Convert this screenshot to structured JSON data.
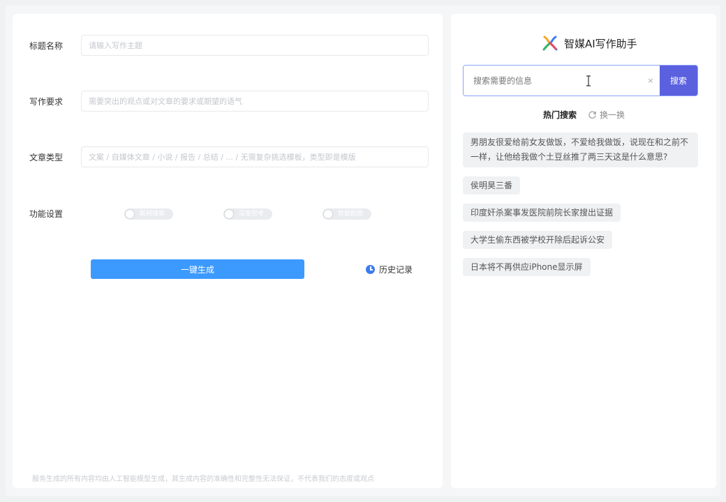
{
  "form": {
    "title_label": "标题名称",
    "title_placeholder": "请输入写作主题",
    "req_label": "写作要求",
    "req_placeholder": "需要突出的观点或对文章的要求或期望的语气",
    "type_label": "文章类型",
    "type_placeholder": "文案 / 自媒体文章 / 小说 / 报告 / 总结 / ... / 无需复杂挑选模板，类型即是模版",
    "func_label": "功能设置",
    "toggles": [
      {
        "label": "联网搜索"
      },
      {
        "label": "深度思考"
      },
      {
        "label": "智能配图"
      }
    ],
    "generate_label": "一键生成",
    "history_label": "历史记录",
    "disclaimer": "服务生成的所有内容均由人工智能模型生成，其生成内容的准确性和完整性无法保证，不代表我们的态度或观点"
  },
  "assistant": {
    "title": "智媒AI写作助手",
    "search_placeholder": "搜索需要的信息",
    "clear_symbol": "×",
    "search_button": "搜索",
    "hot_title": "热门搜索",
    "refresh_label": "换一换",
    "hot_items": [
      "男朋友很爱给前女友做饭，不爱给我做饭，说现在和之前不一样，让他给我做个土豆丝推了两三天这是什么意思?",
      "侯明昊三番",
      "印度奸杀案事发医院前院长家搜出证据",
      "大学生偷东西被学校开除后起诉公安",
      "日本将不再供应iPhone显示屏"
    ]
  },
  "colors": {
    "primary_blue": "#3c9aff",
    "search_purple": "#5b60df"
  }
}
